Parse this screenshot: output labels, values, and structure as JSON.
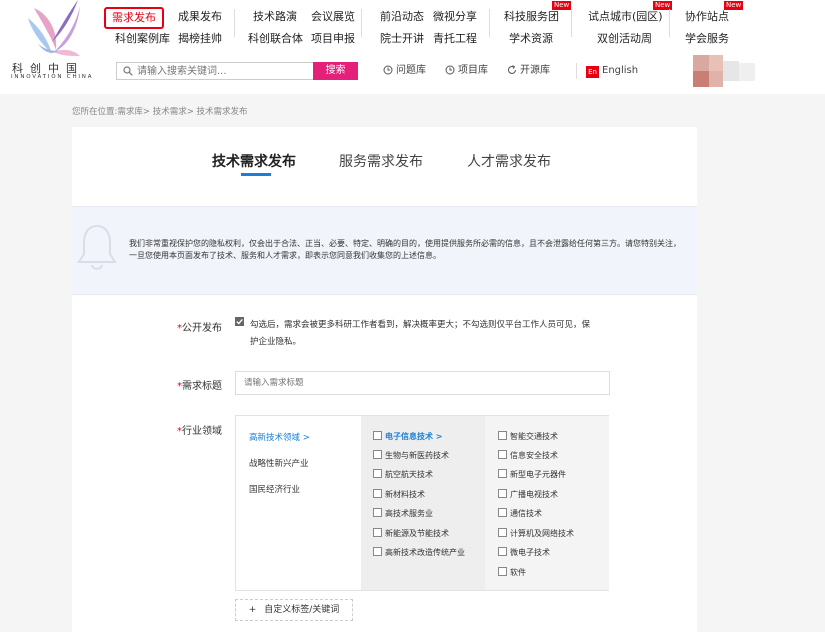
{
  "brand": {
    "name_cn": "科创中国",
    "name_en": "INNOVATION CHINA"
  },
  "nav": {
    "row1": [
      "需求发布",
      "成果发布",
      "技术路演",
      "会议展览",
      "前沿动态",
      "微视分享",
      "科技服务团",
      "试点城市(园区)",
      "协作站点"
    ],
    "row2": [
      "科创案例库",
      "揭榜挂帅",
      "科创联合体",
      "项目申报",
      "院士开讲",
      "青托工程",
      "学术资源",
      "双创活动周",
      "学会服务"
    ],
    "badge": "New"
  },
  "search": {
    "placeholder": "请输入搜索关键词...",
    "button": "搜索"
  },
  "tools": {
    "question_bank": "问题库",
    "project_bank": "项目库",
    "open_source": "开源库",
    "language": "English",
    "language_icon": "En"
  },
  "breadcrumb": "您所在位置:需求库> 技术需求> 技术需求发布",
  "tabs": [
    "技术需求发布",
    "服务需求发布",
    "人才需求发布"
  ],
  "notice": "我们非常重视保护您的隐私权利，仅会出于合法、正当、必要、特定、明确的目的，使用提供服务所必需的信息，且不会泄露给任何第三方。请您特别关注，一旦您使用本页面发布了技术、服务和人才需求，即表示您同意我们收集您的上述信息。",
  "form": {
    "public_label": "公开发布",
    "public_checked": true,
    "public_desc": "勾选后，需求会被更多科研工作者看到，解决概率更大；不勾选则仅平台工作人员可见，保护企业隐私。",
    "title_label": "需求标题",
    "title_placeholder": "请输入需求标题",
    "industry_label": "行业领域",
    "categories": [
      "高新技术领域 >",
      "战略性新兴产业",
      "国民经济行业"
    ],
    "sub_col2": [
      "电子信息技术 >",
      "生物与新医药技术",
      "航空航天技术",
      "新材料技术",
      "高技术服务业",
      "新能源及节能技术",
      "高新技术改造传统产业"
    ],
    "sub_col3": [
      "智能交通技术",
      "信息安全技术",
      "新型电子元器件",
      "广播电视技术",
      "通信技术",
      "计算机及网络技术",
      "微电子技术",
      "软件"
    ],
    "custom_tag": "自定义标签/关键词",
    "plus": "+"
  },
  "colors": {
    "accent": "#1a7fd6",
    "red": "#e60012",
    "search_pink": "#e4207a"
  }
}
